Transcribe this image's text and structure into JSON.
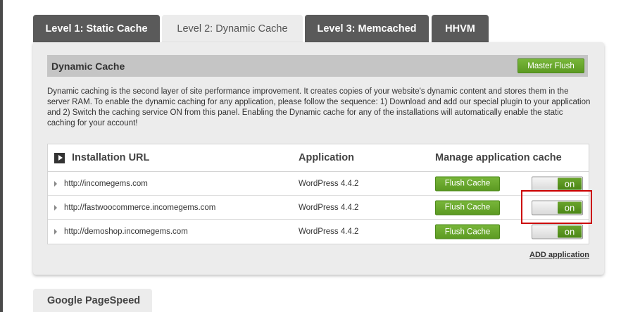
{
  "tabs": [
    {
      "label": "Level 1: Static Cache"
    },
    {
      "label": "Level 2: Dynamic Cache"
    },
    {
      "label": "Level 3: Memcached"
    },
    {
      "label": "HHVM"
    }
  ],
  "section": {
    "title": "Dynamic Cache",
    "master_flush_label": "Master Flush",
    "description": "Dynamic caching is the second layer of site performance improvement. It creates copies of your website's dynamic content and stores them in the server RAM. To enable the dynamic caching for any application, please follow the sequence: 1) Download and add our special plugin to your application and 2) Switch the caching service ON from this panel. Enabling the Dynamic cache for any of the installations will automatically enable the static caching for your account!"
  },
  "table": {
    "headers": {
      "url": "Installation URL",
      "application": "Application",
      "manage": "Manage application cache"
    },
    "rows": [
      {
        "url": "http://incomegems.com",
        "application": "WordPress 4.4.2",
        "flush_label": "Flush Cache",
        "toggle_label": "on"
      },
      {
        "url": "http://fastwoocommerce.incomegems.com",
        "application": "WordPress 4.4.2",
        "flush_label": "Flush Cache",
        "toggle_label": "on"
      },
      {
        "url": "http://demoshop.incomegems.com",
        "application": "WordPress 4.4.2",
        "flush_label": "Flush Cache",
        "toggle_label": "on"
      }
    ]
  },
  "add_application_label": "ADD application",
  "bottom_tab_label": "Google PageSpeed",
  "colors": {
    "accent_green": "#6aa42c",
    "tab_dark": "#5a5a5a",
    "highlight": "#cc0000"
  }
}
